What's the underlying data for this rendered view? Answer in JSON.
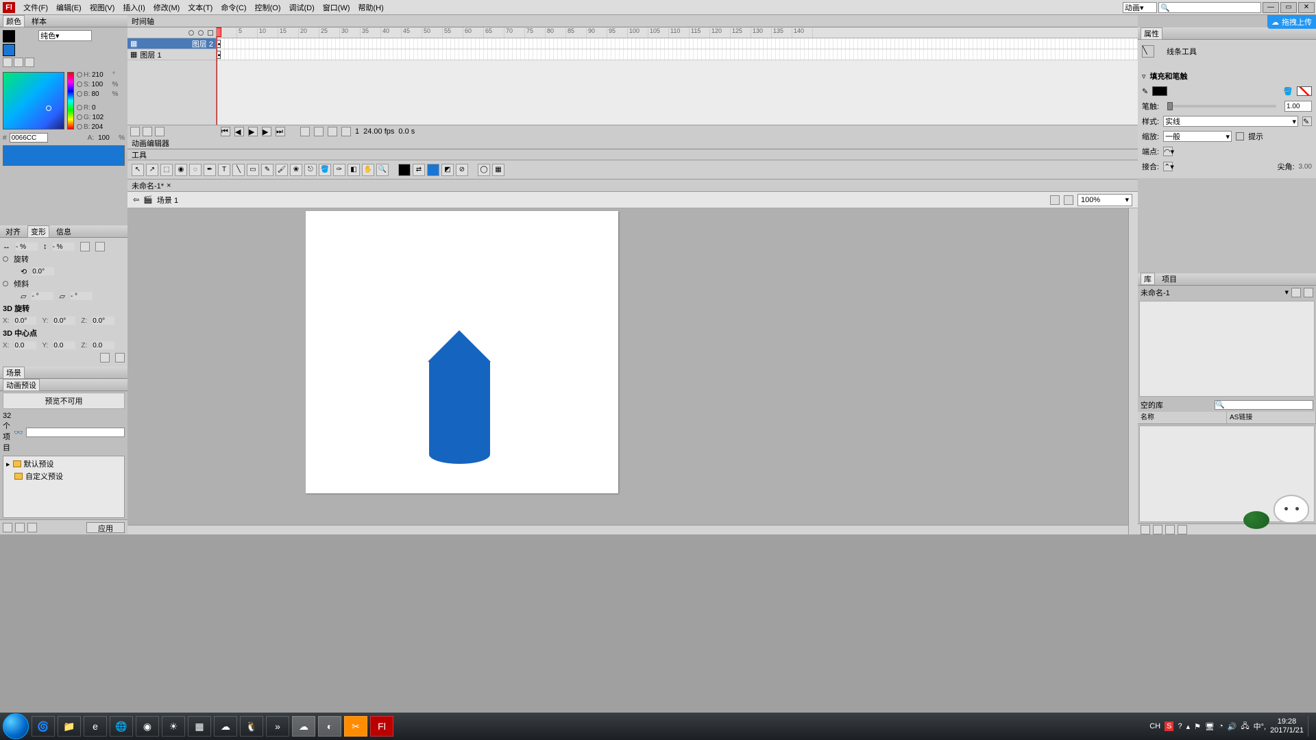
{
  "menu": {
    "items": [
      "文件(F)",
      "编辑(E)",
      "视图(V)",
      "插入(I)",
      "修改(M)",
      "文本(T)",
      "命令(C)",
      "控制(O)",
      "调试(D)",
      "窗口(W)",
      "帮助(H)"
    ],
    "workspace": "动画",
    "search_placeholder": "🔍"
  },
  "upload_label": "拖拽上传",
  "left": {
    "color": {
      "tabs": [
        "颜色",
        "样本"
      ],
      "type": "纯色",
      "hex": "0066CC",
      "H": "210",
      "Hs": "°",
      "S": "100",
      "Ss": "%",
      "B": "80",
      "Bs": "%",
      "R": "0",
      "G": "102",
      "Bl": "204",
      "A": "100",
      "As": "%"
    },
    "transform": {
      "tabs": [
        "对齐",
        "变形",
        "信息"
      ],
      "w": "- %",
      "h": "- %",
      "rotate_lbl": "旋转",
      "rot": "0.0°",
      "skew_lbl": "倾斜",
      "skew": "- °",
      "skew2": "- °",
      "d3r": "3D 旋转",
      "x": "0.0°",
      "y": "0.0°",
      "z": "0.0°",
      "d3c": "3D 中心点",
      "cx": "0.0",
      "cy": "0.0",
      "cz": "0.0"
    },
    "scene": {
      "tab": "场景"
    },
    "preset": {
      "tab": "动画预设",
      "preview": "预览不可用",
      "count": "32 个项目",
      "items": [
        "默认预设",
        "自定义预设"
      ],
      "apply": "应用"
    }
  },
  "timeline": {
    "tab": "时间轴",
    "editor_tab": "动画编辑器",
    "layers": [
      {
        "name": "图层 2",
        "sel": true
      },
      {
        "name": "图层 1",
        "sel": false
      }
    ],
    "marks": [
      "1",
      "5",
      "10",
      "15",
      "20",
      "25",
      "30",
      "35",
      "40",
      "45",
      "50",
      "55",
      "60",
      "65",
      "70",
      "75",
      "80",
      "85",
      "90",
      "95",
      "100",
      "105",
      "110",
      "115",
      "120",
      "125",
      "130",
      "135",
      "140"
    ],
    "fps": "24.00 fps",
    "time": "0.0 s",
    "frame": "1"
  },
  "tools": {
    "tab": "工具"
  },
  "doc": {
    "tab": "未命名-1*",
    "scene": "场景 1",
    "zoom": "100%"
  },
  "props": {
    "tab": "属性",
    "tool": "线条工具",
    "sec1": "填充和笔触",
    "stroke": "笔触:",
    "stroke_val": "1.00",
    "style": "样式:",
    "style_val": "实线",
    "scale": "缩放:",
    "scale_val": "一般",
    "hint": "提示",
    "cap": "端点:",
    "join": "接合:",
    "miter": "尖角:",
    "miter_val": "3.00"
  },
  "lib": {
    "tabs": [
      "库",
      "项目"
    ],
    "doc": "未命名-1",
    "empty": "空的库",
    "cols": [
      "名称",
      "AS链接"
    ]
  },
  "tray": {
    "ime": "CH",
    "ime2": "中°,",
    "time": "19:28",
    "date": "2017/1/21"
  }
}
